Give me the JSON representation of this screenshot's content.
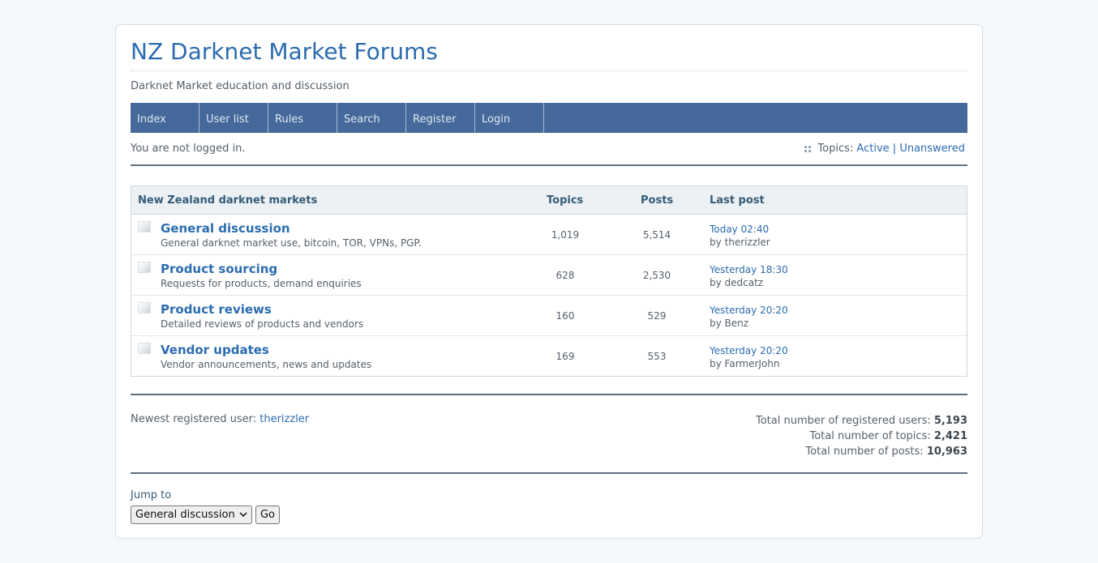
{
  "header": {
    "title": "NZ Darknet Market Forums",
    "description": "Darknet Market education and discussion"
  },
  "nav": {
    "items": [
      {
        "label": "Index"
      },
      {
        "label": "User list"
      },
      {
        "label": "Rules"
      },
      {
        "label": "Search"
      },
      {
        "label": "Register"
      },
      {
        "label": "Login"
      }
    ]
  },
  "status": {
    "login_text": "You are not logged in.",
    "topics_label": "Topics:",
    "active_link": "Active",
    "separator": "|",
    "unanswered_link": "Unanswered"
  },
  "category": {
    "name": "New Zealand darknet markets",
    "col_topics": "Topics",
    "col_posts": "Posts",
    "col_last_post": "Last post",
    "forums": [
      {
        "name": "General discussion",
        "desc": "General darknet market use, bitcoin, TOR, VPNs, PGP.",
        "topics": "1,019",
        "posts": "5,514",
        "last_time": "Today 02:40",
        "last_by": "by therizzler"
      },
      {
        "name": "Product sourcing",
        "desc": "Requests for products, demand enquiries",
        "topics": "628",
        "posts": "2,530",
        "last_time": "Yesterday 18:30",
        "last_by": "by dedcatz"
      },
      {
        "name": "Product reviews",
        "desc": "Detailed reviews of products and vendors",
        "topics": "160",
        "posts": "529",
        "last_time": "Yesterday 20:20",
        "last_by": "by Benz"
      },
      {
        "name": "Vendor updates",
        "desc": "Vendor announcements, news and updates",
        "topics": "169",
        "posts": "553",
        "last_time": "Yesterday 20:20",
        "last_by": "by FarmerJohn"
      }
    ]
  },
  "stats": {
    "newest_label": "Newest registered user:",
    "newest_user": "therizzler",
    "users_label": "Total number of registered users:",
    "users_value": "5,193",
    "topics_label": "Total number of topics:",
    "topics_value": "2,421",
    "posts_label": "Total number of posts:",
    "posts_value": "10,963"
  },
  "jump": {
    "label": "Jump to",
    "selected": "General discussion",
    "go_label": "Go"
  },
  "colors": {
    "nav_bg": "#45699a",
    "link": "#2b6cb0",
    "table_head_bg": "#ecf1f5"
  }
}
